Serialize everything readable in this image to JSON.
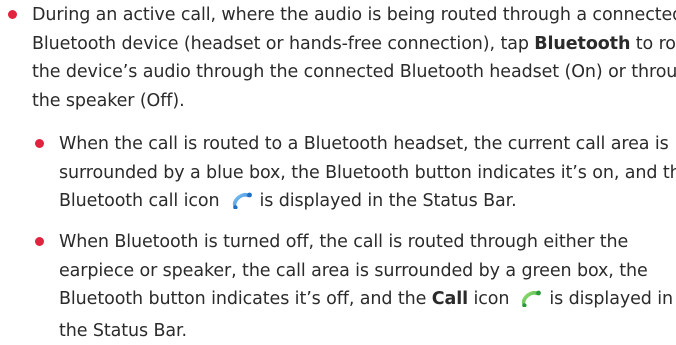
{
  "items": [
    {
      "lines": [
        {
          "pre": "During an active call, where the audio is being routed through a connected"
        },
        {
          "pre": "Bluetooth device (headset or hands-free connection), tap ",
          "strong": "Bluetooth",
          "post": " to route"
        },
        {
          "pre": "the device’s audio through the connected Bluetooth headset (On) or through"
        },
        {
          "pre": "the speaker (Off)."
        }
      ]
    },
    {
      "lines": [
        {
          "pre": "When the call is routed to a Bluetooth headset, the current call area is"
        },
        {
          "pre": "surrounded by a blue box, the Bluetooth button indicates it’s on, and the"
        },
        {
          "pre": "Bluetooth call icon",
          "post": "is displayed in the Status Bar."
        }
      ]
    },
    {
      "lines": [
        {
          "pre": "When Bluetooth is turned off, the call is routed through either the"
        },
        {
          "pre": "earpiece or speaker, the call area is surrounded by a green box, the"
        },
        {
          "pre": "Bluetooth button indicates it’s off, and the ",
          "strong": "Call",
          "post": " icon",
          "post2": "is displayed in"
        },
        {
          "pre": "the Status Bar."
        }
      ]
    }
  ],
  "icons": {
    "bluetooth_call": "bluetooth-call-icon",
    "call": "call-icon"
  },
  "colors": {
    "bullet": "#e2233f",
    "bluetooth_call_icon": "#2f8fd8",
    "call_icon": "#39b54a",
    "text": "#2b2b2b"
  }
}
